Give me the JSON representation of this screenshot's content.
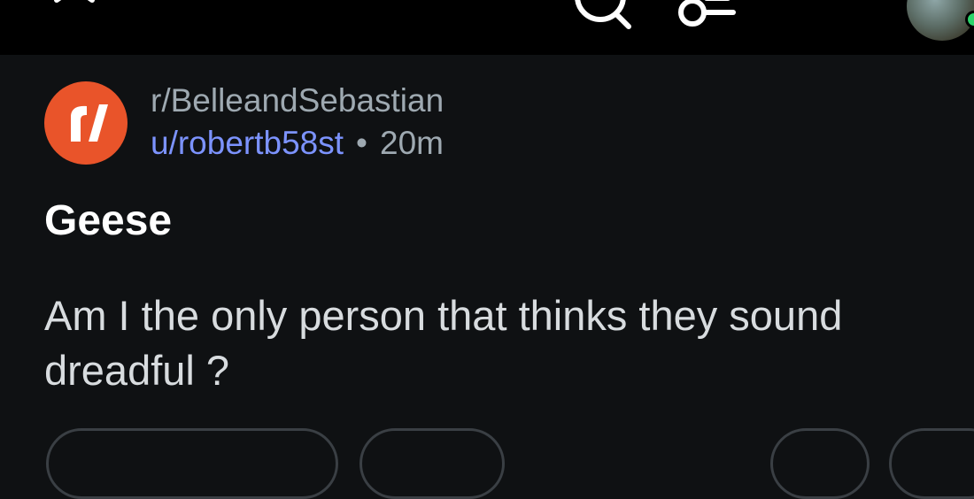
{
  "topbar": {
    "close_icon": "close-icon",
    "search_icon": "search-icon",
    "key_icon": "key-icon",
    "more_icon": "more-icon"
  },
  "post": {
    "subreddit": "r/BelleandSebastian",
    "username": "u/robertb58st",
    "separator": "•",
    "time_ago": "20m",
    "title": "Geese",
    "body": "Am I the only person that thinks they sound dreadful ?"
  },
  "colors": {
    "background": "#0f1113",
    "topbar": "#000000",
    "subreddit_logo": "#e9542a",
    "username": "#7c93ff",
    "muted": "#9ea9b1",
    "title": "#ffffff",
    "body": "#d8dcdf"
  }
}
